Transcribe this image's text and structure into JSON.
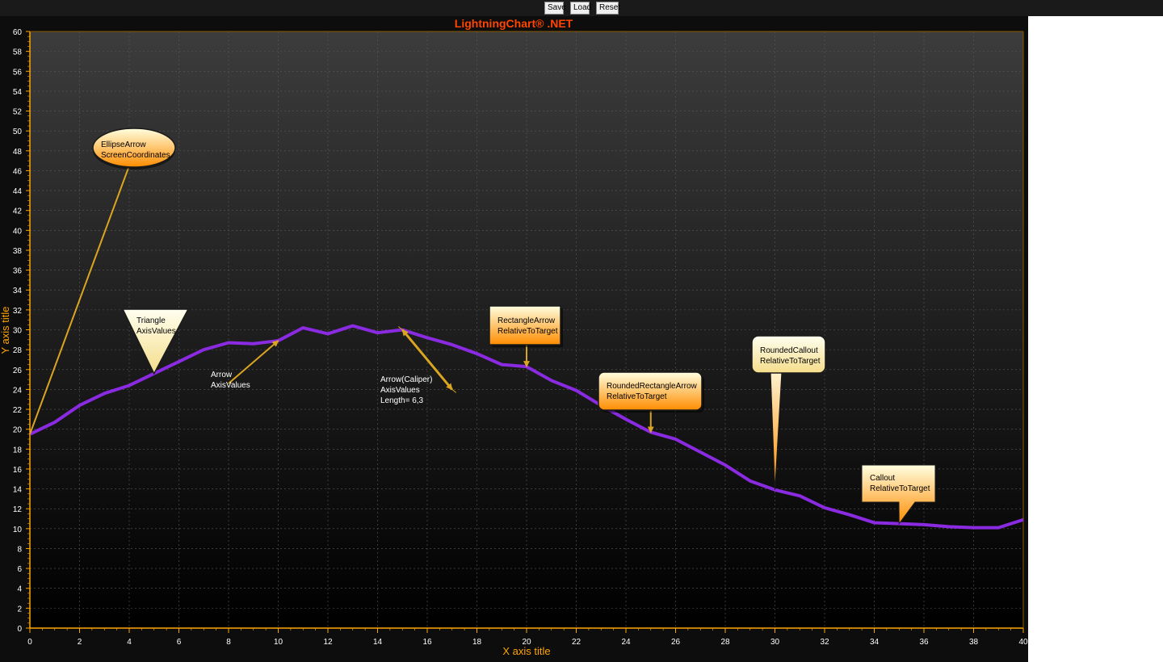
{
  "toolbar": {
    "save_label": "Save",
    "load_label": "Load",
    "reset_label": "Reset"
  },
  "colors": {
    "title": "#ff4500",
    "axis": "#ffa500",
    "series": "#8a2be2",
    "annotation_fill_top": "#ffffe0",
    "annotation_fill_bottom": "#ff8c00",
    "annotation_arrow": "#daa520"
  },
  "chart_data": {
    "type": "line",
    "title": "LightningChart® .NET",
    "xlabel": "X axis title",
    "ylabel": "Y axis title",
    "xlim": [
      0,
      40
    ],
    "ylim": [
      0,
      60
    ],
    "xticks": [
      0,
      2,
      4,
      6,
      8,
      10,
      12,
      14,
      16,
      18,
      20,
      22,
      24,
      26,
      28,
      30,
      32,
      34,
      36,
      38,
      40
    ],
    "yticks": [
      0,
      2,
      4,
      6,
      8,
      10,
      12,
      14,
      16,
      18,
      20,
      22,
      24,
      26,
      28,
      30,
      32,
      34,
      36,
      38,
      40,
      42,
      44,
      46,
      48,
      50,
      52,
      54,
      56,
      58,
      60
    ],
    "grid": true,
    "series": [
      {
        "x": [
          0,
          1,
          2,
          3,
          4,
          5,
          6,
          7,
          8,
          9,
          10,
          11,
          12,
          13,
          14,
          15,
          16,
          17,
          18,
          19,
          20,
          21,
          22,
          23,
          24,
          25,
          26,
          27,
          28,
          29,
          30,
          31,
          32,
          33,
          34,
          35,
          36,
          37,
          38,
          39,
          40
        ],
        "y": [
          19.5,
          20.7,
          22.4,
          23.6,
          24.4,
          25.6,
          26.8,
          28.0,
          28.7,
          28.6,
          28.9,
          30.2,
          29.6,
          30.4,
          29.7,
          30.0,
          29.2,
          28.5,
          27.6,
          26.5,
          26.3,
          24.9,
          23.9,
          22.4,
          21.0,
          19.7,
          19.0,
          17.7,
          16.4,
          14.8,
          13.9,
          13.3,
          12.1,
          11.4,
          10.6,
          10.5,
          10.4,
          10.2,
          10.1,
          10.1,
          10.9
        ]
      }
    ],
    "annotations": [
      {
        "style": "EllipseArrow",
        "lines": [
          "EllipseArrow",
          "ScreenCoordinates"
        ],
        "target": [
          0,
          19.5
        ]
      },
      {
        "style": "Triangle",
        "lines": [
          "Triangle",
          "AxisValues"
        ],
        "target": [
          5,
          25.6
        ]
      },
      {
        "style": "Arrow",
        "lines": [
          "Arrow",
          "AxisValues"
        ],
        "from": [
          8,
          24.6
        ],
        "to": [
          10,
          28.9
        ]
      },
      {
        "style": "Caliper",
        "lines": [
          "Arrow(Caliper)",
          "AxisValues",
          "Length= 6,3"
        ],
        "from": [
          15,
          30
        ],
        "to": [
          17,
          24
        ]
      },
      {
        "style": "RectangleArrow",
        "lines": [
          "RectangleArrow",
          "RelativeToTarget"
        ],
        "target": [
          20,
          26.3
        ]
      },
      {
        "style": "RoundedRectangleArrow",
        "lines": [
          "RoundedRectangleArrow",
          "RelativeToTarget"
        ],
        "target": [
          25,
          19.7
        ]
      },
      {
        "style": "RoundedCallout",
        "lines": [
          "RoundedCallout",
          "RelativeToTarget"
        ],
        "target": [
          30,
          13.9
        ]
      },
      {
        "style": "Callout",
        "lines": [
          "Callout",
          "RelativeToTarget"
        ],
        "target": [
          35,
          10.5
        ]
      }
    ]
  }
}
